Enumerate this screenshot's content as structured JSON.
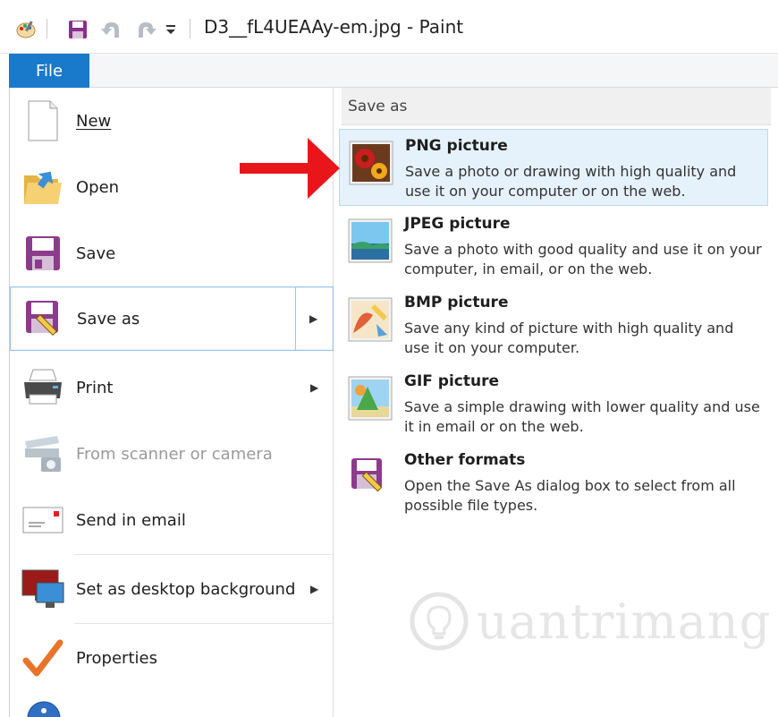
{
  "window": {
    "title": "D3__fL4UEAAy-em.jpg - Paint"
  },
  "quick_access": {
    "icons": [
      "paint-palette-icon",
      "save-disk-icon",
      "undo-icon",
      "redo-icon",
      "customize-dropdown-icon"
    ]
  },
  "ribbon": {
    "file_tab_label": "File"
  },
  "menu": {
    "items": [
      {
        "label": "New",
        "icon": "new-document-icon",
        "has_submenu": false,
        "enabled": true
      },
      {
        "label": "Open",
        "icon": "open-folder-icon",
        "has_submenu": false,
        "enabled": true
      },
      {
        "label": "Save",
        "icon": "save-disk-icon",
        "has_submenu": false,
        "enabled": true
      },
      {
        "label": "Save as",
        "icon": "save-as-icon",
        "has_submenu": true,
        "enabled": true,
        "selected": true
      },
      {
        "label": "Print",
        "icon": "printer-icon",
        "has_submenu": true,
        "enabled": true
      },
      {
        "label": "From scanner or camera",
        "icon": "scanner-camera-icon",
        "has_submenu": false,
        "enabled": false
      },
      {
        "label": "Send in email",
        "icon": "email-icon",
        "has_submenu": false,
        "enabled": true
      },
      {
        "label": "Set as desktop background",
        "icon": "desktop-background-icon",
        "has_submenu": true,
        "enabled": true
      },
      {
        "label": "Properties",
        "icon": "checkmark-icon",
        "has_submenu": false,
        "enabled": true
      }
    ]
  },
  "save_as_panel": {
    "heading": "Save as",
    "options": [
      {
        "title": "PNG picture",
        "description": "Save a photo or drawing with high quality and use it on your computer or on the web.",
        "icon": "png-flower-icon",
        "highlighted": true
      },
      {
        "title": "JPEG picture",
        "description": "Save a photo with good quality and use it on your computer, in email, or on the web.",
        "icon": "jpeg-landscape-icon",
        "highlighted": false
      },
      {
        "title": "BMP picture",
        "description": "Save any kind of picture with high quality and use it on your computer.",
        "icon": "bmp-painting-icon",
        "highlighted": false
      },
      {
        "title": "GIF picture",
        "description": "Save a simple drawing with lower quality and use it in email or on the web.",
        "icon": "gif-shapes-icon",
        "highlighted": false
      },
      {
        "title": "Other formats",
        "description": "Open the Save As dialog box to select from all possible file types.",
        "icon": "save-as-icon",
        "highlighted": false
      }
    ]
  },
  "annotation": {
    "arrow_color": "#e8161b"
  },
  "watermark": {
    "text": "uantrimang"
  },
  "colors": {
    "file_tab": "#1979ca",
    "hover_bg": "#e5f1fb",
    "hover_border": "#b9d7f2"
  }
}
